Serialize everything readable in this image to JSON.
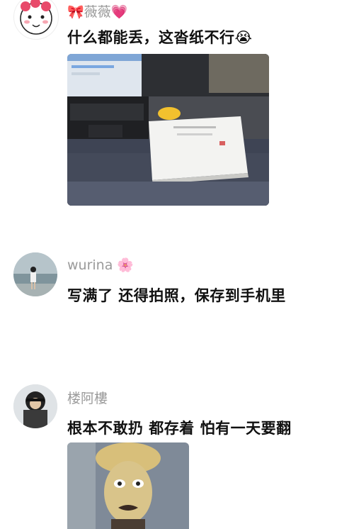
{
  "comments": [
    {
      "username": "薇薇",
      "name_decoration_left": "🎀",
      "name_decoration_right": "💗",
      "text": "什么都能丢，这沓纸不行",
      "text_emoji": "😭"
    },
    {
      "username": "wurina",
      "name_decoration_right": "🌸",
      "text": "写满了 还得拍照，保存到手机里"
    },
    {
      "username": "楼阿樓",
      "text": "根本不敢扔 都存着 怕有一天要翻"
    }
  ],
  "colors": {
    "username": "#9a9a9a",
    "text": "#111111",
    "background": "#ffffff"
  }
}
